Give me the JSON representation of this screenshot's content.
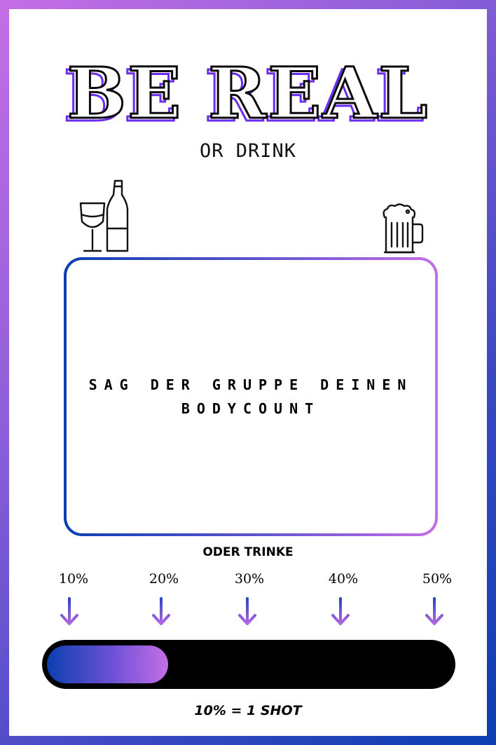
{
  "card": {
    "title": "BE REAL",
    "subtitle": "OR DRINK",
    "prompt": "SAG DER GRUPPE DEINEN BODYCOUNT",
    "or_drink_label": "ODER TRINKE",
    "footer": "10% = 1 SHOT"
  },
  "icons": {
    "left": "wine-glass-and-bottle-icon",
    "right": "beer-mug-icon",
    "arrows": "arrow-down-icon"
  },
  "scale": {
    "labels": [
      "10%",
      "20%",
      "30%",
      "40%",
      "50%"
    ],
    "progress_percent": 30
  },
  "colors": {
    "gradient_blue": "#0b3fb0",
    "gradient_purple": "#6a2cf0",
    "gradient_pink": "#c56ee6",
    "ink": "#000000"
  }
}
